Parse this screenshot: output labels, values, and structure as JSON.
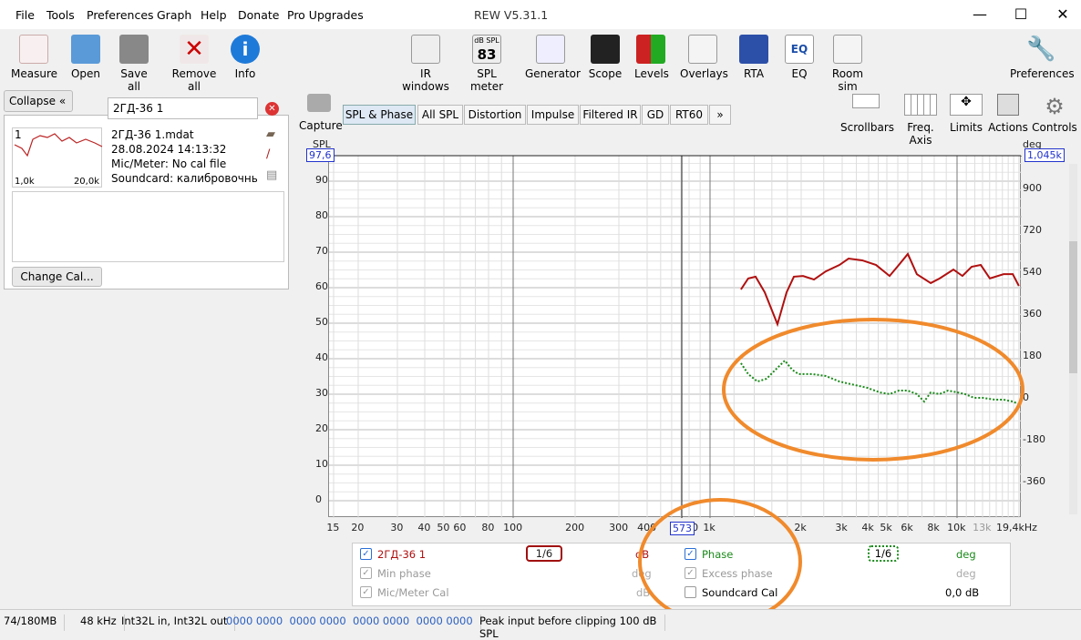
{
  "window": {
    "title": "REW V5.31.1",
    "minimize": "—",
    "maximize": "☐",
    "close": "✕"
  },
  "menu": [
    "File",
    "Tools",
    "Preferences",
    "Graph",
    "Help",
    "Donate",
    "Pro Upgrades"
  ],
  "toolbar_left": [
    "Measure",
    "Open",
    "Save all",
    "Remove all",
    "Info"
  ],
  "toolbar_mid": [
    "IR windows",
    "SPL meter",
    "Generator",
    "Scope",
    "Levels",
    "Overlays",
    "RTA",
    "EQ",
    "Room sim"
  ],
  "spl_meter_icon": {
    "top": "dB SPL",
    "value": "83"
  },
  "toolbar_right": "Preferences",
  "panel": {
    "collapse": "Collapse",
    "name_value": "2ГД-36 1",
    "thumb_label": "1",
    "thumb_x_min": "1,0k",
    "thumb_x_max": "20,0k",
    "file": "2ГД-36 1.mdat",
    "date": "28.08.2024 14:13:32",
    "mic": "Mic/Meter: No cal file",
    "soundcard": "Soundcard: калибровочный с",
    "change_cal": "Change Cal..."
  },
  "capture": "Capture",
  "tabs": [
    "SPL & Phase",
    "All SPL",
    "Distortion",
    "Impulse",
    "Filtered IR",
    "GD",
    "RT60",
    "»"
  ],
  "graph_tools": [
    "Scrollbars",
    "Freq. Axis",
    "Limits",
    "Actions",
    "Controls"
  ],
  "chart_data": {
    "type": "line",
    "ylabel_left": "SPL",
    "ylabel_right": "deg",
    "top_left_value": "97,6",
    "top_right_value": "1,045k",
    "cursor_label": "573",
    "y_ticks": [
      "90",
      "80",
      "70",
      "60",
      "50",
      "40",
      "30",
      "20",
      "10",
      "0"
    ],
    "y_right_ticks": [
      "900",
      "720",
      "540",
      "360",
      "180",
      "0",
      "-180",
      "-360"
    ],
    "x_ticks": [
      "15",
      "20",
      "30",
      "40",
      "50",
      "60",
      "80",
      "100",
      "200",
      "300",
      "400",
      "800",
      "1k",
      "2k",
      "3k",
      "4k",
      "5k",
      "6k",
      "8k",
      "10k",
      "13k",
      "19,4kHz"
    ],
    "ylim": [
      0,
      97.6
    ],
    "y_right_lim": [
      -360,
      1045
    ],
    "series": [
      {
        "name": "2ГД-36 1",
        "color": "#b01010",
        "unit": "dB",
        "freq": [
          1265,
          1337,
          1414,
          1516,
          1670,
          1790,
          1892,
          2037,
          2270,
          2550,
          2920,
          3215,
          3730,
          4380,
          5120,
          5550,
          6000,
          6620,
          7700,
          8430,
          9650,
          10570,
          11620,
          12760,
          14030,
          16200,
          17830,
          19000
        ],
        "values": [
          59.5,
          62.6,
          63.1,
          58.7,
          49.7,
          58.7,
          63.1,
          63.3,
          62.3,
          64.6,
          66.4,
          68.2,
          67.7,
          66.4,
          63.3,
          66.4,
          69.5,
          63.8,
          61.3,
          62.6,
          65.1,
          63.3,
          65.9,
          66.4,
          62.6,
          63.8,
          63.8,
          60.5
        ]
      },
      {
        "name": "Phase",
        "color": "#1a8a1a",
        "unit": "deg",
        "freq": [
          1265,
          1337,
          1434,
          1537,
          1646,
          1766,
          1867,
          1958,
          2230,
          2550,
          2920,
          3440,
          3940,
          4600,
          5120,
          5550,
          6000,
          6620,
          7170,
          7700,
          8430,
          9150,
          10080,
          10850,
          11900,
          13000,
          14800,
          16200,
          17830,
          19000
        ],
        "values": [
          153,
          106,
          74,
          86,
          125,
          164,
          125,
          106,
          106,
          98,
          74,
          59,
          47,
          27,
          20,
          35,
          35,
          20,
          -12,
          27,
          20,
          35,
          27,
          20,
          4,
          4,
          -4,
          -4,
          -12,
          -23
        ]
      }
    ]
  },
  "legend": {
    "rows": [
      {
        "label": "2ГД-36 1",
        "unit": "dB",
        "checked": true,
        "smoothing": "1/6"
      },
      {
        "label": "Min phase",
        "unit": "deg",
        "checked": true
      },
      {
        "label": "Mic/Meter Cal",
        "unit": "dB",
        "checked": true
      }
    ],
    "rows_right": [
      {
        "label": "Phase",
        "unit": "deg",
        "checked": true,
        "smoothing": "1/6"
      },
      {
        "label": "Excess phase",
        "unit": "deg",
        "checked": true
      },
      {
        "label": "Soundcard Cal",
        "unit": "0,0 dB",
        "checked": false
      }
    ]
  },
  "status": [
    "74/180MB",
    "48 kHz",
    "Int32L in, Int32L out",
    "0000 0000  0000 0000  0000 0000  0000 0000",
    "Peak input before clipping 100 dB SPL"
  ]
}
